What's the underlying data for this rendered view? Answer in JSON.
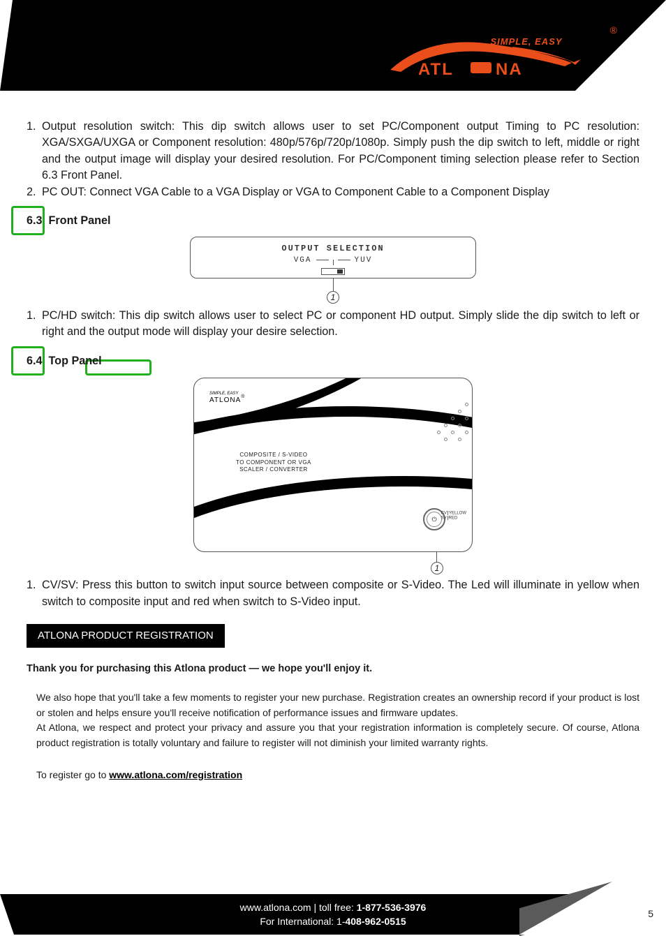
{
  "header": {
    "tagline": "SIMPLE, EASY",
    "brand": "ATLONA",
    "registered": "®"
  },
  "section62": {
    "items": [
      {
        "num": "1.",
        "text": "Output resolution switch: This dip switch allows user to set PC/Component output Timing to PC resolution: XGA/SXGA/UXGA or Component resolution: 480p/576p/720p/1080p. Simply push the dip switch to left, middle or right and the output image will display your desired resolution. For PC/Component timing selection please refer to Section 6.3 Front Panel."
      },
      {
        "num": "2.",
        "text": "PC OUT: Connect VGA Cable to a VGA Display or VGA to Component Cable to a Component Display"
      }
    ]
  },
  "section63": {
    "heading": "6.3. Front Panel",
    "diagram": {
      "title": "OUTPUT SELECTION",
      "left": "VGA",
      "right": "YUV",
      "callout": "1"
    },
    "items": [
      {
        "num": "1.",
        "text": "PC/HD switch: This dip switch allows user to select PC or component HD output. Simply slide the dip switch to left or right and the output mode will display your desire selection."
      }
    ]
  },
  "section64": {
    "heading": "6.4. Top Panel",
    "diagram": {
      "logo_small": "SIMPLE, EASY",
      "logo": "ATLONA",
      "line1": "Composite / S-Video",
      "line2": "to Component or VGA",
      "line3": "Scaler / Converter",
      "btn_l1": "CV",
      "btn_r1": "YELLOW",
      "btn_l2": "SV",
      "btn_r2": "RED",
      "callout": "1"
    },
    "items": [
      {
        "num": "1.",
        "text": "CV/SV: Press this button to switch input source between composite or S-Video. The Led will illuminate in yellow when switch to composite input and red when switch to S-Video input."
      }
    ]
  },
  "registration": {
    "label": "ATLONA PRODUCT REGISTRATION",
    "thanks": "Thank you for purchasing this Atlona   product — we hope you'll enjoy it.",
    "p1": "We also hope that you'll take a few moments to register your new purchase. Registration creates an ownership record if your product is lost or stolen and helps ensure you'll receive notification of performance issues and firmware updates.",
    "p2": "At Atlona, we respect and protect your privacy and assure you that your registration information is completely secure. Of course, Atlona product registration is totally voluntary and failure to register will not diminish your limited warranty rights.",
    "p3_prefix": "To register go to ",
    "p3_link": "www.atlona.com/registration"
  },
  "footer": {
    "line1_a": "www.atlona.com | toll free: ",
    "line1_b": "1-877-536-3976",
    "line2_a": "For International: 1-",
    "line2_b": "408-962-0515",
    "page": "5"
  }
}
